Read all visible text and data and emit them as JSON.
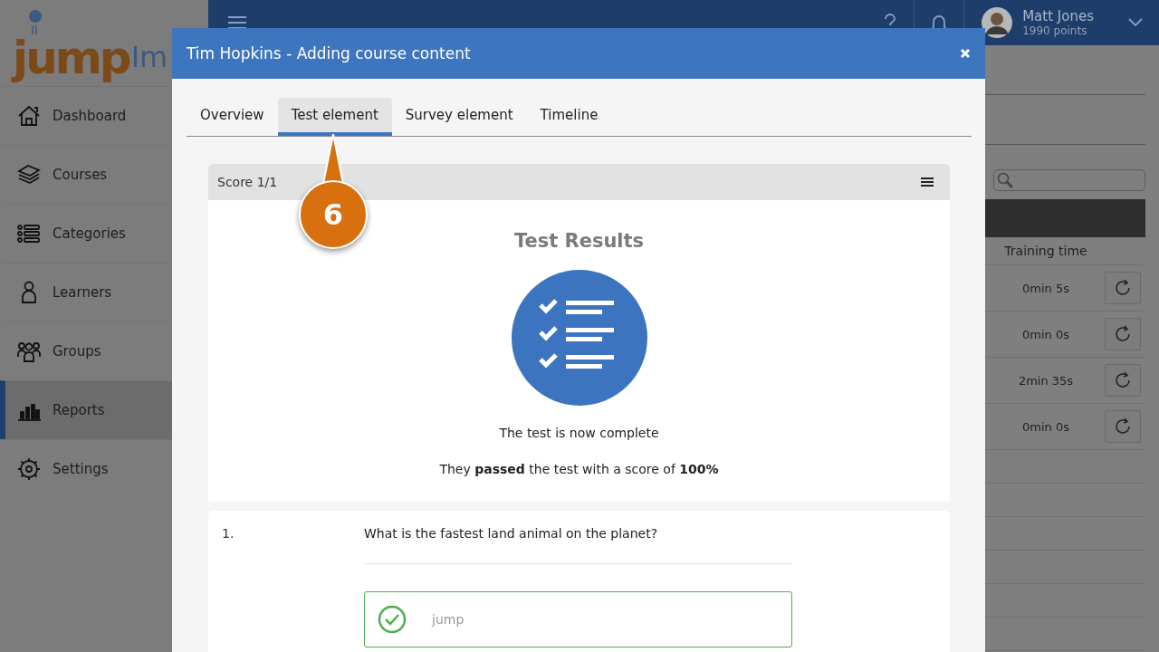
{
  "logo": {
    "text": "jump",
    "suffix": "Im"
  },
  "sidebar": {
    "items": [
      {
        "label": "Dashboard",
        "kind": "home",
        "selected": false
      },
      {
        "label": "Courses",
        "kind": "stack",
        "selected": false
      },
      {
        "label": "Categories",
        "kind": "list",
        "selected": false
      },
      {
        "label": "Learners",
        "kind": "person",
        "selected": false
      },
      {
        "label": "Groups",
        "kind": "group",
        "selected": false
      },
      {
        "label": "Reports",
        "kind": "chart",
        "selected": true
      },
      {
        "label": "Settings",
        "kind": "gear",
        "selected": false
      }
    ]
  },
  "header": {
    "user": {
      "name": "Matt Jones",
      "points": "1990 points"
    }
  },
  "report": {
    "columns": [
      "Training time"
    ],
    "rows": [
      {
        "training_time": "0min 5s"
      },
      {
        "training_time": "0min 0s"
      },
      {
        "training_time": "2min 35s"
      },
      {
        "training_time": "0min 0s"
      }
    ]
  },
  "modal": {
    "title": "Tim Hopkins - Adding course content",
    "tabs": [
      {
        "label": "Overview",
        "selected": false
      },
      {
        "label": "Test element",
        "selected": true
      },
      {
        "label": "Survey element",
        "selected": false
      },
      {
        "label": "Timeline",
        "selected": false
      }
    ],
    "card": {
      "score": "Score 1/1",
      "heading": "Test Results",
      "status": "The test is now complete",
      "result": "They **passed** the test with a score of **100%**"
    },
    "questions": [
      {
        "number": "1.",
        "text": "What is the fastest land animal on the planet?",
        "answers": [
          {
            "text": "jump",
            "correct": true
          }
        ]
      }
    ]
  },
  "callout": {
    "text": "6"
  }
}
